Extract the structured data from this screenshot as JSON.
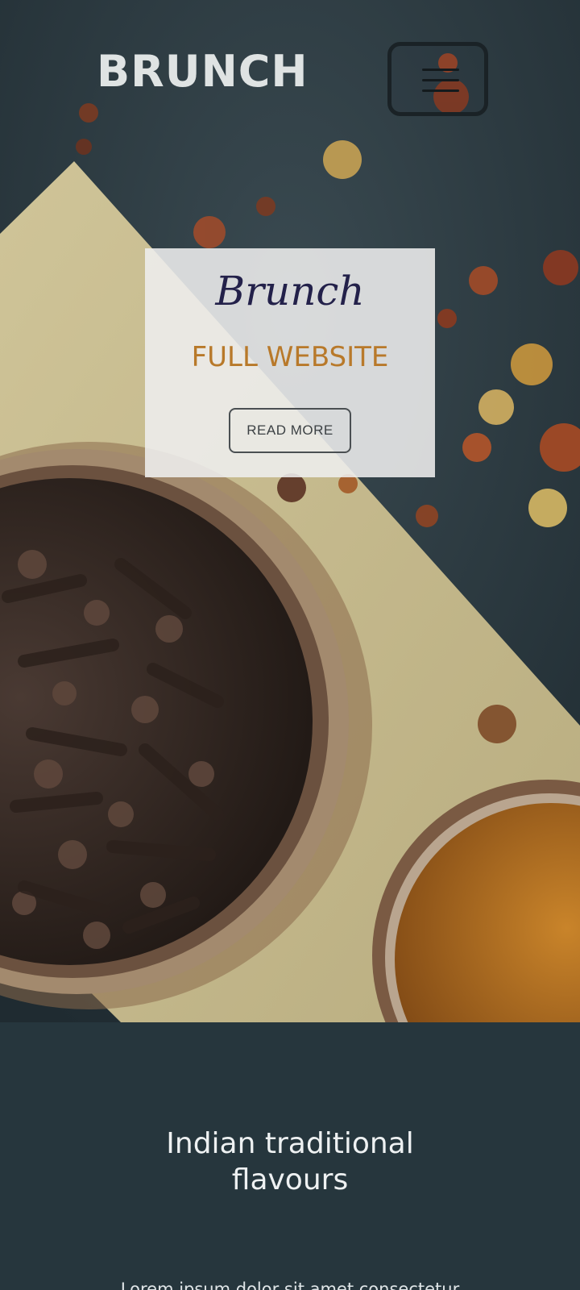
{
  "header": {
    "brand": "BRUNCH",
    "menu_icon": "hamburger-menu-icon"
  },
  "hero": {
    "script_title": "Brunch",
    "title": "FULL WEBSITE",
    "button_label": "READ MORE",
    "background": "spices-photo"
  },
  "section": {
    "heading_line1": "Indian traditional",
    "heading_line2": "flavours",
    "body_text": "Lorem ipsum dolor sit amet consectetur"
  },
  "colors": {
    "brand_text": "#dfe3e3",
    "accent_title": "#b8792a",
    "script_title": "#23214a",
    "section_background": "#26363d"
  }
}
